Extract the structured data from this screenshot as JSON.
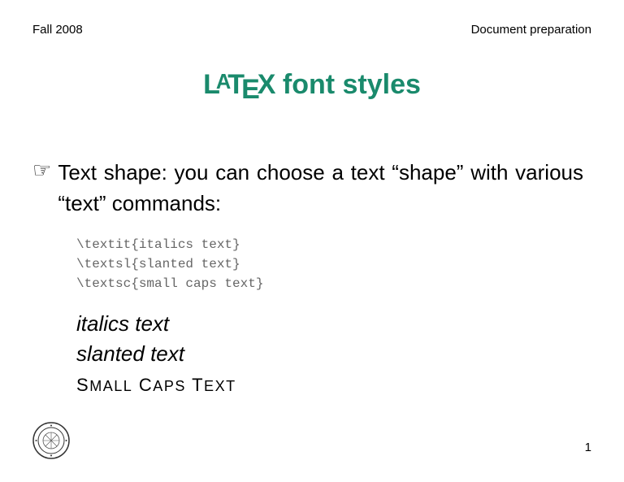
{
  "header": {
    "left": "Fall 2008",
    "right": "Document preparation"
  },
  "title": {
    "latex": "LATEX",
    "rest": "  font styles"
  },
  "body": {
    "intro": "Text shape: you can choose a text “shape” with various “text” commands:",
    "code": [
      "\\textit{italics text}",
      "\\textsl{slanted text}",
      "\\textsc{small caps text}"
    ],
    "samples": {
      "italic": "italics text",
      "slanted": "slanted text",
      "smallcaps": "SMALL CAPS TEXT"
    }
  },
  "footer": {
    "seal_alt": "Florida State University seal",
    "page": "1"
  }
}
